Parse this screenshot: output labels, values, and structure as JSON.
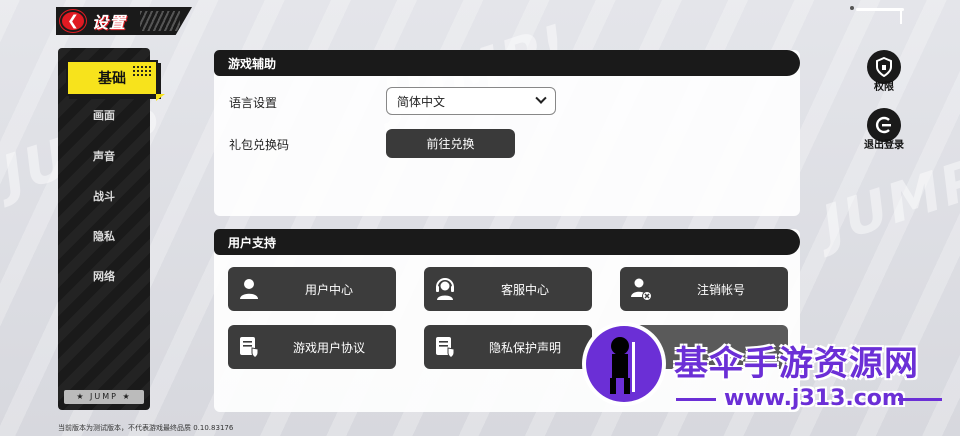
{
  "header": {
    "title": "设置",
    "back_icon": "arrow-left-icon"
  },
  "sidebar": {
    "items": [
      {
        "label": "基础",
        "active": true
      },
      {
        "label": "画面"
      },
      {
        "label": "声音"
      },
      {
        "label": "战斗"
      },
      {
        "label": "隐私"
      },
      {
        "label": "网络"
      }
    ],
    "footer": "★ JUMP ★"
  },
  "game_assist": {
    "title": "游戏辅助",
    "language_label": "语言设置",
    "language_value": "简体中文",
    "giftcode_label": "礼包兑换码",
    "giftcode_button": "前往兑换"
  },
  "user_support": {
    "title": "用户支持",
    "buttons": [
      {
        "label": "用户中心",
        "icon": "user-icon"
      },
      {
        "label": "客服中心",
        "icon": "headset-icon"
      },
      {
        "label": "注销帐号",
        "icon": "user-remove-icon"
      },
      {
        "label": "游戏用户协议",
        "icon": "document-shield-icon"
      },
      {
        "label": "隐私保护声明",
        "icon": "document-shield-icon"
      }
    ]
  },
  "right_actions": {
    "permissions": "权限",
    "logout": "退出登录"
  },
  "bottom_note": "当前版本为测试版本，不代表游戏最终品质 0.10.83176",
  "watermark": {
    "site_name": "基伞手游资源网",
    "site_url": "www.j313.com"
  },
  "colors": {
    "accent": "#f7e31c",
    "red": "#e01a22",
    "dark": "#1a1a1a",
    "brand": "#6b2fd6"
  }
}
